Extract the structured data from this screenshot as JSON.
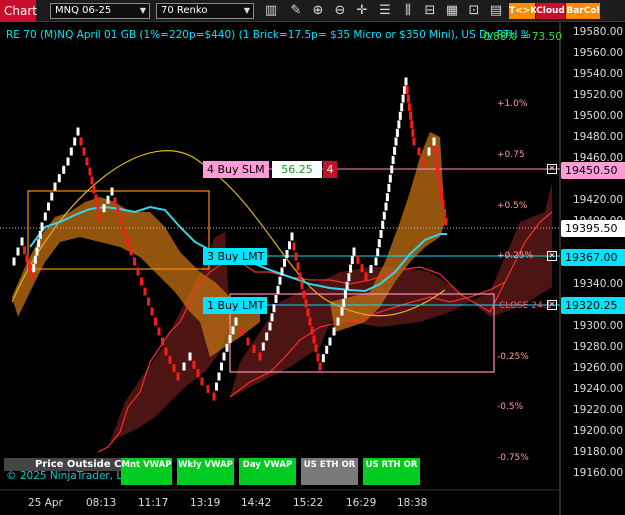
{
  "toolbar": {
    "chart_tab": "Chart",
    "instrument": "MNQ 06-25",
    "bar_type": "70 Renko",
    "tk_label": "T<>K",
    "cloud_label": "Cloud",
    "barcol_label": "BarCol"
  },
  "chart": {
    "title": "RE 70 (M)NQ April 01 GB (1%=220p=$440) (1 Brick=17.5p= $35 Micro or $350 Mini), US Dy RTH %",
    "title_pct": "0.88% = 73.50",
    "pct_levels": [
      "+1.0%",
      "+0.75",
      "+0.5%",
      "+0.25%",
      "-0.25%",
      "-0.5%",
      "-0.75%"
    ],
    "close_label": "CLOSE 24.1",
    "y_axis": [
      "19580.00",
      "19560.00",
      "19540.00",
      "19520.00",
      "19500.00",
      "19480.00",
      "19460.00",
      "19440.00",
      "19420.00",
      "19400.00",
      "19380.00",
      "19360.00",
      "19340.00",
      "19320.00",
      "19300.00",
      "19280.00",
      "19260.00",
      "19240.00",
      "19220.00",
      "19200.00",
      "19180.00",
      "19160.00"
    ],
    "x_axis": [
      "25 Apr",
      "08:13",
      "11:17",
      "13:19",
      "14:42",
      "15:22",
      "16:29",
      "18:38"
    ],
    "price_tags": {
      "sell_target": "19450.50",
      "last": "19395.50",
      "buy_lmt3": "19367.00",
      "buy_lmt1": "19320.25"
    },
    "orders": {
      "buy_slm_label": "4 Buy SLM",
      "buy_slm_price": "56.25",
      "buy_slm_qty": "4",
      "buy_lmt3_label": "3 Buy LMT",
      "buy_lmt1_label": "1 Buy LMT"
    },
    "colors": {
      "up_brick": "#ffffff",
      "down_brick": "#ff1a1a",
      "cloud": "#b86a10",
      "bear_cloud": "#5a1818",
      "vwap": "#35d6e6"
    }
  },
  "bottom": {
    "price_outside": "Price Outside Clo",
    "copyright": "© 2025 NinjaTrader, LLC",
    "vwap_buttons": [
      "Mnt VWAP",
      "Wkly VWAP",
      "Day VWAP",
      "US ETH OR",
      "US RTH OR"
    ]
  }
}
